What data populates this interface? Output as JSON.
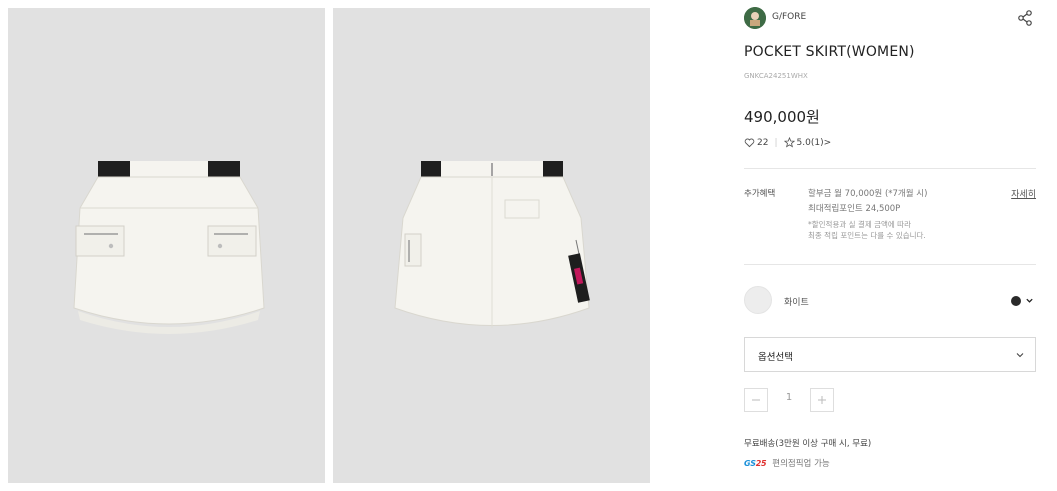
{
  "brand": {
    "name": "G/FORE",
    "logo_icon": "brand-avatar-icon"
  },
  "product": {
    "title": "POCKET SKIRT(WOMEN)",
    "code": "GNKCA24251WHX",
    "price": "490,000원"
  },
  "stats": {
    "likes": "22",
    "rating": "5.0",
    "reviews": "(1)",
    "reviews_arrow": ">"
  },
  "benefits": {
    "label": "추가혜택",
    "line1": "할부금 월 70,000원 (*7개월 시)",
    "line2": "최대적립포인트 24,500P",
    "note1": "*할인적용과 실 결제 금액에 따라",
    "note2": "최종 적립 포인트는 다를 수 있습니다.",
    "detail_link": "자세히"
  },
  "color": {
    "selected_name": "화이트",
    "swatch_color": "#ededed",
    "alt_color": "#2a2a2a"
  },
  "option_select": {
    "label": "옵션선택"
  },
  "quantity": {
    "value": "1"
  },
  "shipping": {
    "text": "무료배송(3만원 이상 구매 시, 무료)"
  },
  "store_pickup": {
    "logo_text": "GS",
    "logo_num": "25",
    "text": "편의점픽업 가능"
  },
  "colors": {
    "photo_bg": "#e1e1e1",
    "skirt": "#f5f4ef",
    "band": "#1e1e1e",
    "tab": "#c2185b"
  }
}
